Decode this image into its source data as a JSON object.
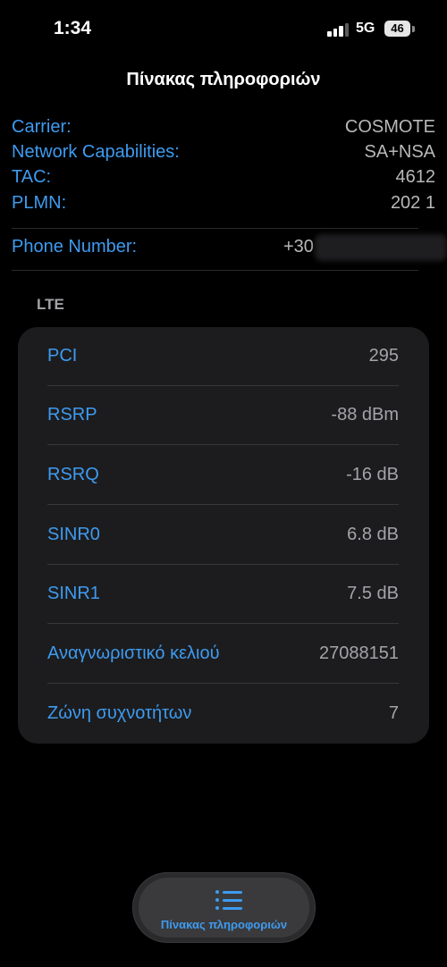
{
  "status_bar": {
    "time": "1:34",
    "network": "5G",
    "battery": "46"
  },
  "title": "Πίνακας πληροφοριών",
  "info": {
    "rows": [
      {
        "label": "Carrier:",
        "value": "COSMOTE"
      },
      {
        "label": "Network Capabilities:",
        "value": "SA+NSA"
      },
      {
        "label": "TAC:",
        "value": "4612"
      },
      {
        "label": "PLMN:",
        "value": "202 1"
      }
    ],
    "phone": {
      "label": "Phone Number:",
      "value": "+30"
    }
  },
  "lte": {
    "header": "LTE",
    "rows": [
      {
        "label": "PCI",
        "value": "295"
      },
      {
        "label": "RSRP",
        "value": "-88 dBm"
      },
      {
        "label": "RSRQ",
        "value": "-16 dB"
      },
      {
        "label": "SINR0",
        "value": "6.8 dB"
      },
      {
        "label": "SINR1",
        "value": "7.5 dB"
      },
      {
        "label": "Αναγνωριστικό κελιού",
        "value": "27088151"
      },
      {
        "label": "Ζώνη συχνοτήτων",
        "value": "7"
      }
    ]
  },
  "tab_bar": {
    "label": "Πίνακας πληροφοριών",
    "icon": "list-icon"
  },
  "colors": {
    "accent": "#3e9bf0",
    "background": "#000000",
    "card": "#1c1c1e",
    "value_text": "#a4a4a8"
  }
}
